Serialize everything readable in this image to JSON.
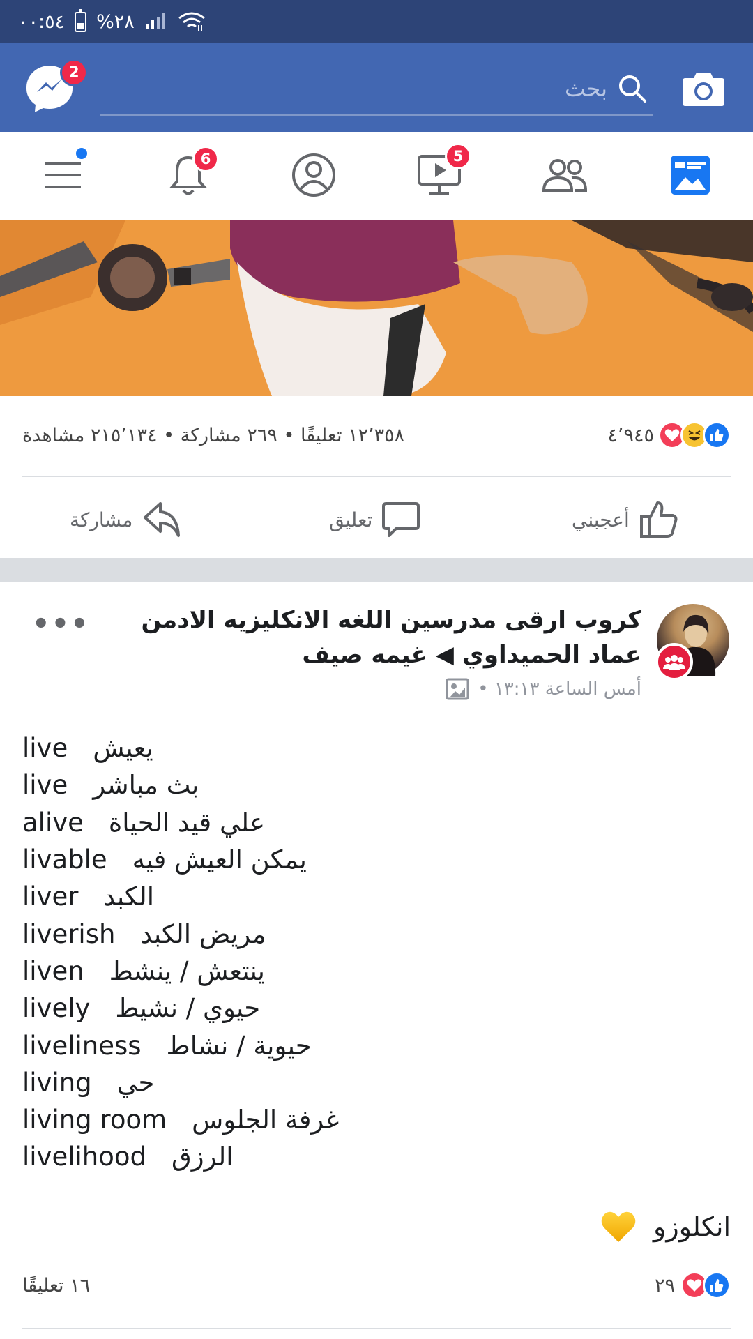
{
  "status_bar": {
    "time": "٠٠:٥٤",
    "battery": "%٢٨"
  },
  "header": {
    "search_placeholder": "بحث",
    "messenger_badge": "2"
  },
  "tabs": {
    "watch_badge": "5",
    "notifications_badge": "6"
  },
  "post1": {
    "reaction_count": "٤٬٩٤٥",
    "stats": "١٢٬٣٥٨ تعليقًا • ٢٦٩ مشاركة • ٢١٥٬١٣٤ مشاهدة",
    "like_label": "أعجبني",
    "comment_label": "تعليق",
    "share_label": "مشاركة"
  },
  "post2": {
    "title": "كروب ارقى مدرسين اللغه الانكليزيه الادمن عماد الحميداوي ◀ غيمه صيف",
    "time": "أمس الساعة ١٣:١٣ •",
    "vocab": [
      {
        "en": "live",
        "ar": "يعيش"
      },
      {
        "en": "live",
        "ar": "بث مباشر"
      },
      {
        "en": "alive",
        "ar": "علي قيد الحياة"
      },
      {
        "en": "livable",
        "ar": "يمكن العيش فيه"
      },
      {
        "en": "liver",
        "ar": "الكبد"
      },
      {
        "en": "liverish",
        "ar": "مريض الكبد"
      },
      {
        "en": "liven",
        "ar": "ينتعش / ينشط"
      },
      {
        "en": "lively",
        "ar": "حيوي / نشيط"
      },
      {
        "en": "liveliness",
        "ar": "حيوية / نشاط"
      },
      {
        "en": "living",
        "ar": "حي"
      },
      {
        "en": "living room",
        "ar": "غرفة الجلوس"
      },
      {
        "en": "livelihood",
        "ar": "الرزق"
      }
    ],
    "closing_text": "انكلوزو",
    "reaction_count": "٢٩",
    "comments": "١٦ تعليقًا"
  },
  "colors": {
    "status_bar": "#2d4477",
    "header": "#4267b2",
    "accent": "#1877f2",
    "badge": "#f02849"
  }
}
